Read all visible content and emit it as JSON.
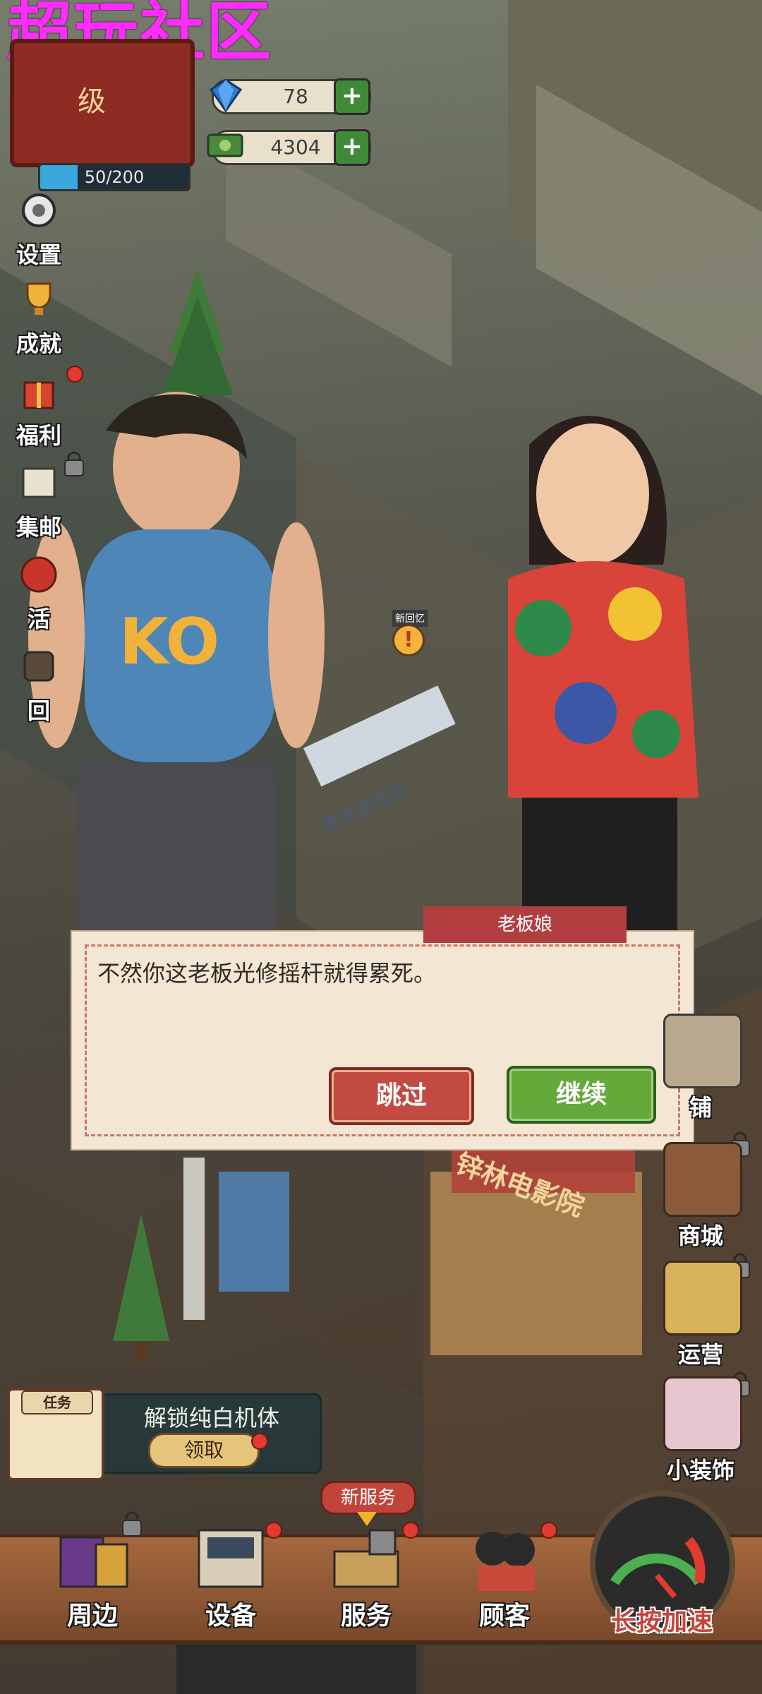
{
  "watermark": "超玩社区",
  "player": {
    "level_text": "级",
    "exp_current": 50,
    "exp_max": 200,
    "exp_text": "50/200"
  },
  "currency": {
    "gems": "78",
    "cash": "4304",
    "plus": "+"
  },
  "left_menu": [
    {
      "label": "设置",
      "icon": "gear-icon"
    },
    {
      "label": "成就",
      "icon": "trophy-icon"
    },
    {
      "label": "福利",
      "icon": "gift-icon"
    },
    {
      "label": "集邮",
      "icon": "stamp-icon"
    },
    {
      "label": "活",
      "icon": "event-icon"
    },
    {
      "label": "回",
      "icon": "return-icon"
    }
  ],
  "scene_labels": {
    "new_memory": "新回忆",
    "shop_sign": "胜景游戏店",
    "cinema_sign": "锌林电影院"
  },
  "dialog": {
    "speaker": "老板娘",
    "text": "不然你这老板光修摇杆就得累死。",
    "skip_label": "跳过",
    "continue_label": "继续"
  },
  "right_menu": [
    {
      "label": "铺",
      "icon": "shop-icon"
    },
    {
      "label": "商城",
      "icon": "mall-icon"
    },
    {
      "label": "运营",
      "icon": "operations-icon"
    },
    {
      "label": "小装饰",
      "icon": "decoration-icon"
    }
  ],
  "quest": {
    "tag": "任务",
    "title": "解锁纯白机体",
    "button": "领取"
  },
  "bottom_bar": {
    "items": [
      {
        "label": "周边",
        "icon": "merch-icon"
      },
      {
        "label": "设备",
        "icon": "equipment-icon"
      },
      {
        "label": "服务",
        "icon": "service-icon"
      },
      {
        "label": "顾客",
        "icon": "customers-icon"
      }
    ],
    "new_service_tag": "新服务",
    "speed_label": "长按加速"
  },
  "colors": {
    "accent_red": "#c24a42",
    "accent_green": "#65a93b",
    "watermark": "#ff2bff"
  }
}
